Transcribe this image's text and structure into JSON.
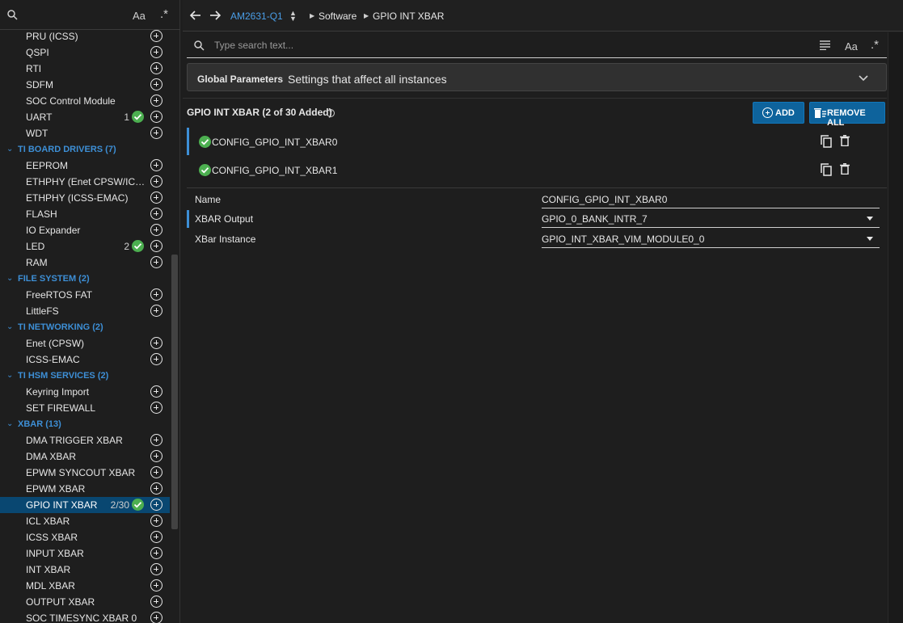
{
  "sidebar": {
    "search_aa": "Aa",
    "search_regex": ".*",
    "items": [
      {
        "type": "item",
        "label": "PRU (ICSS)",
        "count": "",
        "ok": false
      },
      {
        "type": "item",
        "label": "QSPI",
        "count": "",
        "ok": false
      },
      {
        "type": "item",
        "label": "RTI",
        "count": "",
        "ok": false
      },
      {
        "type": "item",
        "label": "SDFM",
        "count": "",
        "ok": false
      },
      {
        "type": "item",
        "label": "SOC Control Module",
        "count": "",
        "ok": false
      },
      {
        "type": "item",
        "label": "UART",
        "count": "1",
        "ok": true
      },
      {
        "type": "item",
        "label": "WDT",
        "count": "",
        "ok": false
      },
      {
        "type": "category",
        "label": "TI BOARD DRIVERS (7)"
      },
      {
        "type": "item",
        "label": "EEPROM",
        "count": "",
        "ok": false
      },
      {
        "type": "item",
        "label": "ETHPHY (Enet CPSW/ICSS-EMAC)",
        "count": "",
        "ok": false
      },
      {
        "type": "item",
        "label": "ETHPHY (ICSS-EMAC)",
        "count": "",
        "ok": false
      },
      {
        "type": "item",
        "label": "FLASH",
        "count": "",
        "ok": false
      },
      {
        "type": "item",
        "label": "IO Expander",
        "count": "",
        "ok": false
      },
      {
        "type": "item",
        "label": "LED",
        "count": "2",
        "ok": true
      },
      {
        "type": "item",
        "label": "RAM",
        "count": "",
        "ok": false
      },
      {
        "type": "category",
        "label": "FILE SYSTEM (2)"
      },
      {
        "type": "item",
        "label": "FreeRTOS FAT",
        "count": "",
        "ok": false
      },
      {
        "type": "item",
        "label": "LittleFS",
        "count": "",
        "ok": false
      },
      {
        "type": "category",
        "label": "TI NETWORKING (2)"
      },
      {
        "type": "item",
        "label": "Enet (CPSW)",
        "count": "",
        "ok": false
      },
      {
        "type": "item",
        "label": "ICSS-EMAC",
        "count": "",
        "ok": false
      },
      {
        "type": "category",
        "label": "TI HSM SERVICES (2)"
      },
      {
        "type": "item",
        "label": "Keyring Import",
        "count": "",
        "ok": false
      },
      {
        "type": "item",
        "label": "SET FIREWALL",
        "count": "",
        "ok": false
      },
      {
        "type": "category",
        "label": "XBAR (13)"
      },
      {
        "type": "item",
        "label": "DMA TRIGGER XBAR",
        "count": "",
        "ok": false
      },
      {
        "type": "item",
        "label": "DMA XBAR",
        "count": "",
        "ok": false
      },
      {
        "type": "item",
        "label": "EPWM SYNCOUT XBAR",
        "count": "",
        "ok": false
      },
      {
        "type": "item",
        "label": "EPWM XBAR",
        "count": "",
        "ok": false
      },
      {
        "type": "item",
        "label": "GPIO INT XBAR",
        "count": "2/30",
        "ok": true,
        "selected": true
      },
      {
        "type": "item",
        "label": "ICL XBAR",
        "count": "",
        "ok": false
      },
      {
        "type": "item",
        "label": "ICSS XBAR",
        "count": "",
        "ok": false
      },
      {
        "type": "item",
        "label": "INPUT XBAR",
        "count": "",
        "ok": false
      },
      {
        "type": "item",
        "label": "INT XBAR",
        "count": "",
        "ok": false
      },
      {
        "type": "item",
        "label": "MDL XBAR",
        "count": "",
        "ok": false
      },
      {
        "type": "item",
        "label": "OUTPUT XBAR",
        "count": "",
        "ok": false
      },
      {
        "type": "item",
        "label": "SOC TIMESYNC XBAR 0",
        "count": "",
        "ok": false
      }
    ]
  },
  "topbar": {
    "device": "AM2631-Q1",
    "breadcrumb1": "Software",
    "breadcrumb2": "GPIO INT XBAR"
  },
  "search": {
    "placeholder": "Type search text...",
    "aa": "Aa",
    "regex": ".*"
  },
  "global": {
    "title": "Global Parameters",
    "subtitle": "Settings that affect all instances"
  },
  "instances": {
    "title": "GPIO INT XBAR (2 of 30 Added)",
    "help": "?",
    "add_label": "ADD",
    "remove_all_label": "REMOVE ALL",
    "list": [
      {
        "name": "CONFIG_GPIO_INT_XBAR0",
        "selected": true
      },
      {
        "name": "CONFIG_GPIO_INT_XBAR1",
        "selected": false
      }
    ]
  },
  "properties": [
    {
      "label": "Name",
      "value": "CONFIG_GPIO_INT_XBAR0",
      "dropdown": false,
      "highlight": false
    },
    {
      "label": "XBAR Output",
      "value": "GPIO_0_BANK_INTR_7",
      "dropdown": true,
      "highlight": true
    },
    {
      "label": "XBar Instance",
      "value": "GPIO_INT_XBAR_VIM_MODULE0_0",
      "dropdown": true,
      "highlight": false
    }
  ],
  "colors": {
    "accent": "#3d8fd6",
    "button": "#0e639c",
    "ok": "#4caf50",
    "selected": "#094771"
  }
}
